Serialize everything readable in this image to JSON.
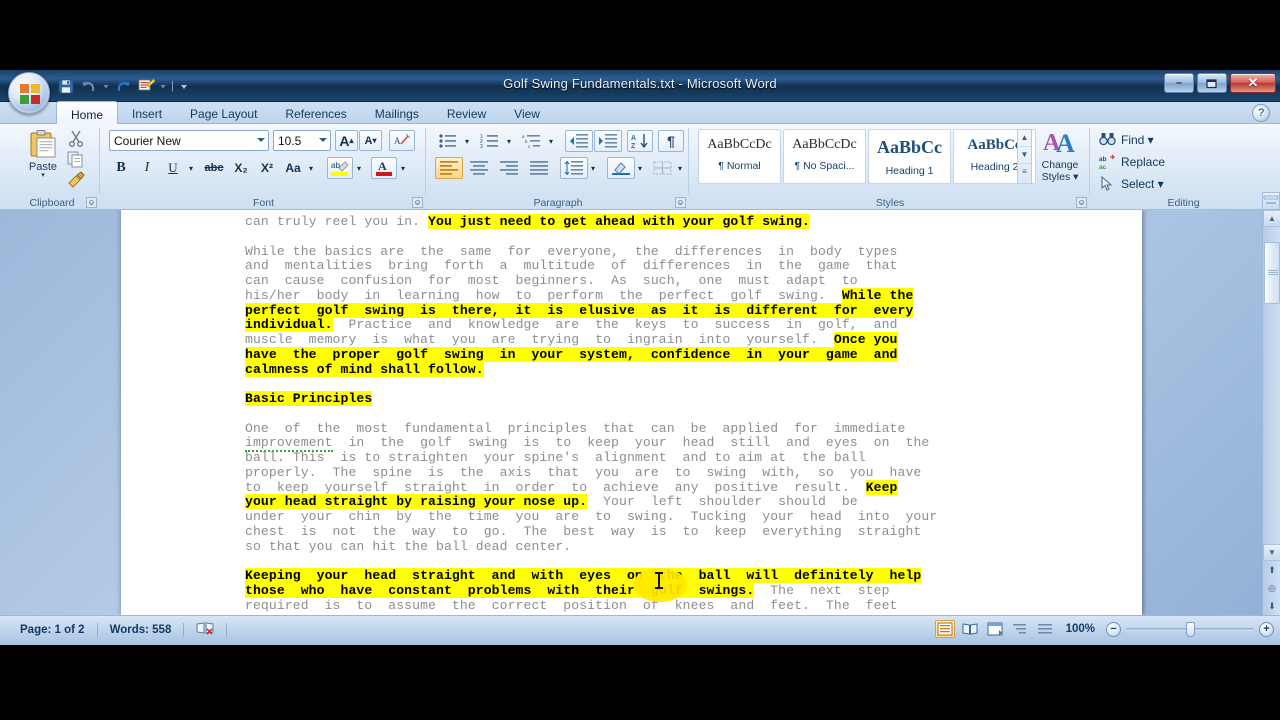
{
  "window": {
    "title": "Golf Swing Fundamentals.txt - Microsoft Word",
    "office_button": "office-orb",
    "minimize": "–",
    "maximize": "❐",
    "close": "✕"
  },
  "quick_access": [
    {
      "name": "save",
      "icon": "save-icon",
      "label": "Save"
    },
    {
      "name": "undo",
      "icon": "undo-icon",
      "label": "Undo"
    },
    {
      "name": "undo-dropdown",
      "icon": "chevron-down-icon",
      "label": "▾"
    },
    {
      "name": "redo",
      "icon": "redo-icon",
      "label": "Redo"
    },
    {
      "name": "quick-print",
      "icon": "print-icon",
      "label": "Quick Print"
    },
    {
      "name": "qat-dropdown",
      "icon": "chevron-down-icon",
      "label": "▾"
    },
    {
      "name": "customize-qat",
      "icon": "chevron-down-icon",
      "label": "▾"
    }
  ],
  "tabs": [
    {
      "label": "Home",
      "active": true
    },
    {
      "label": "Insert",
      "active": false
    },
    {
      "label": "Page Layout",
      "active": false
    },
    {
      "label": "References",
      "active": false
    },
    {
      "label": "Mailings",
      "active": false
    },
    {
      "label": "Review",
      "active": false
    },
    {
      "label": "View",
      "active": false
    }
  ],
  "help_button": "?",
  "ribbon": {
    "clipboard": {
      "group_label": "Clipboard",
      "paste_label": "Paste",
      "paste_arrow": "▾",
      "cut_label": "Cut",
      "copy_label": "Copy",
      "format_painter_label": "Format Painter"
    },
    "font": {
      "group_label": "Font",
      "font_name": "Courier New",
      "font_size": "10.5",
      "grow_font": "A",
      "shrink_font": "A",
      "clear_formatting": "Aa",
      "bold": "B",
      "italic": "I",
      "underline": "U",
      "strikethrough": "abc",
      "subscript": "X₂",
      "superscript": "X²",
      "change_case": "Aa",
      "highlight": "ab",
      "font_color": "A"
    },
    "paragraph": {
      "group_label": "Paragraph",
      "bullets": "bullets-icon",
      "numbering": "numbering-icon",
      "multilevel": "multilevel-list-icon",
      "decrease_indent": "decrease-indent-icon",
      "increase_indent": "increase-indent-icon",
      "sort": "sort-icon",
      "show_marks": "¶",
      "align_left": "align-left-icon",
      "align_center": "align-center-icon",
      "align_right": "align-right-icon",
      "justify": "justify-icon",
      "line_spacing": "line-spacing-icon",
      "shading": "shading-icon",
      "borders": "borders-icon"
    },
    "styles": {
      "group_label": "Styles",
      "items": [
        {
          "preview": "AaBbCcDc",
          "name": "¶ Normal"
        },
        {
          "preview": "AaBbCcDc",
          "name": "¶ No Spaci..."
        },
        {
          "preview": "AaBbCc",
          "name": "Heading 1"
        },
        {
          "preview": "AaBbCc",
          "name": "Heading 2"
        }
      ],
      "change_styles_line1": "Change",
      "change_styles_line2": "Styles ▾",
      "scroll_up": "▲",
      "scroll_down": "▼",
      "more": "≡"
    },
    "editing": {
      "group_label": "Editing",
      "find": "Find ▾",
      "replace": "Replace",
      "select": "Select ▾"
    }
  },
  "document": {
    "paragraphs": [
      {
        "runs": [
          {
            "text": "can truly reel you in. ",
            "highlight": false
          },
          {
            "text": "You just need to get ahead with your golf swing.",
            "highlight": true
          }
        ]
      },
      {
        "runs": [
          {
            "text": "While the basics are  the  same  for  everyone,  the  differences  in  body  types\nand  mentalities  bring  forth  a  multitude  of  differences  in  the  game  that\ncan  cause  confusion  for  most  beginners.  As  such,  one  must  adapt  to\nhis/her  body  in  learning  how  to  perform  the  perfect  golf  swing.  ",
            "highlight": false
          },
          {
            "text": "While the\nperfect  golf  swing  is  there,  it  is  elusive  as  it  is  different  for  every\nindividual.",
            "highlight": true
          },
          {
            "text": "  Practice  and  knowledge  are  the  keys  to  success  in  golf,  and\nmuscle  memory  is  what  you  are  trying  to  ingrain  into  yourself.  ",
            "highlight": false
          },
          {
            "text": "Once you\nhave  the  proper  golf  swing  in  your  system,  confidence  in  your  game  and\ncalmness of mind shall follow.",
            "highlight": true
          }
        ]
      },
      {
        "runs": [
          {
            "text": "Basic Principles",
            "highlight": true
          }
        ]
      },
      {
        "runs": [
          {
            "text": "One  of  the  most  fundamental  principles  that  can  be  applied  for  immediate\n",
            "highlight": false
          },
          {
            "text": "improvement",
            "highlight": false,
            "spelling_error": true
          },
          {
            "text": "  in  the  golf  swing  is  to  keep  your  head  still  and  eyes  on  the\nball. This  is to straighten  your spine's  alignment  and to aim at  the ball\nproperly.  The  spine  is  the  axis  that  you  are  to  swing  with,  so  you  have\nto  keep  yourself  straight  in  order  to  achieve  any  positive  result.  ",
            "highlight": false
          },
          {
            "text": "Keep\nyour head straight by raising your nose up.",
            "highlight": true
          },
          {
            "text": "  Your  left  shoulder  should  be\nunder  your  chin  by  the  time  you  are  to  swing.  Tucking  your  head  into  your\nchest  is  not  the  way  to  go.  The  best  way  is  to  keep  everything  straight\nso that you can hit the ball dead center.",
            "highlight": false
          }
        ]
      },
      {
        "runs": [
          {
            "text": "Keeping  your  head  straight  and  with  eyes  on  the  ball  will  definitely  help\nthose  who  have  constant  problems  with  their  golf  swings.",
            "highlight": true
          },
          {
            "text": "  The  next  step\nrequired  is  to  assume  the  correct  position  of  knees  and  feet.  The  feet",
            "highlight": false
          }
        ]
      }
    ],
    "highlight_color": "#ffff00",
    "spelling_error_color": "#2faa2f"
  },
  "scrollbar": {
    "scroll_up": "▲",
    "scroll_down": "▼",
    "previous_page": "⬆",
    "select_browse_object": "◎",
    "next_page": "⬇",
    "split": "split-handle"
  },
  "status_bar": {
    "page": "Page: 1 of 2",
    "words": "Words: 558",
    "proofing": "proofing-errors-icon",
    "views": [
      {
        "name": "print-layout",
        "icon": "≡",
        "selected": true
      },
      {
        "name": "full-screen-reading",
        "icon": "⊞",
        "selected": false
      },
      {
        "name": "web-layout",
        "icon": "▤",
        "selected": false
      },
      {
        "name": "outline",
        "icon": "≣",
        "selected": false
      },
      {
        "name": "draft",
        "icon": "☰",
        "selected": false
      }
    ],
    "zoom": "100%",
    "zoom_out": "−",
    "zoom_in": "+"
  }
}
